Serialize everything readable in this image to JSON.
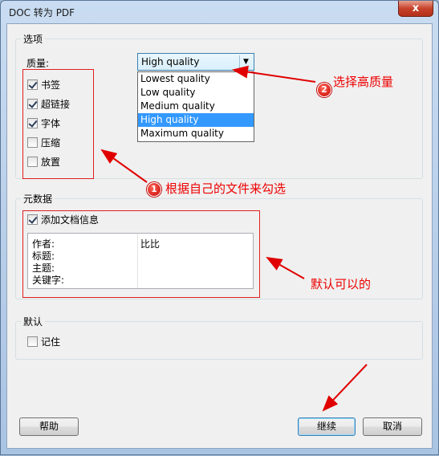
{
  "window": {
    "title": "DOC 转为 PDF",
    "close_label": "x"
  },
  "options": {
    "group_label": "选项",
    "quality_label": "质量:",
    "quality_value": "High quality",
    "quality_options": [
      "Lowest quality",
      "Low quality",
      "Medium quality",
      "High quality",
      "Maximum quality"
    ],
    "checkboxes": [
      {
        "label": "书签",
        "checked": true
      },
      {
        "label": "超链接",
        "checked": true
      },
      {
        "label": "字体",
        "checked": true
      },
      {
        "label": "压缩",
        "checked": false
      },
      {
        "label": "放置",
        "checked": false
      }
    ]
  },
  "metadata": {
    "group_label": "元数据",
    "add_info_label": "添加文档信息",
    "fields": [
      {
        "key": "作者:",
        "value": "比比"
      },
      {
        "key": "标题:",
        "value": ""
      },
      {
        "key": "主题:",
        "value": ""
      },
      {
        "key": "关键字:",
        "value": ""
      }
    ]
  },
  "defaults": {
    "group_label": "默认",
    "remember_label": "记住"
  },
  "buttons": {
    "help": "帮助",
    "continue": "继续",
    "cancel": "取消"
  },
  "annotations": {
    "badge1": "1",
    "text1": "根据自己的文件来勾选",
    "badge2": "2",
    "text2": "选择高质量",
    "text3": "默认可以的"
  },
  "colors": {
    "annotation": "#e00000",
    "selection": "#3399ff"
  }
}
